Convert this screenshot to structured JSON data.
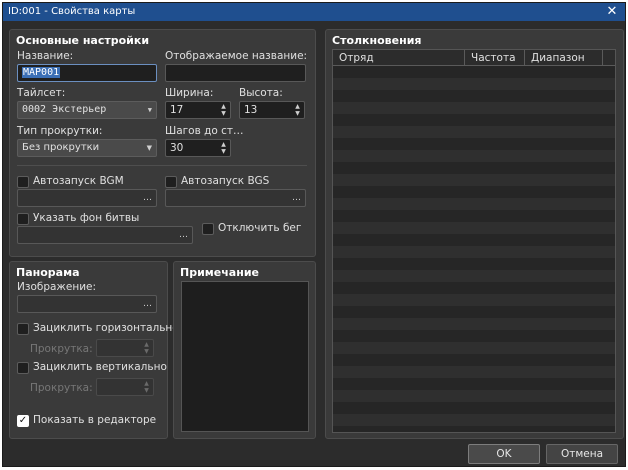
{
  "window": {
    "title": "ID:001 - Свойства карты",
    "close_glyph": "✕"
  },
  "general": {
    "title": "Основные настройки",
    "name_label": "Название:",
    "name_value": "MAP001",
    "display_name_label": "Отображаемое название:",
    "display_name_value": "",
    "tileset_label": "Тайлсет:",
    "tileset_value": "0002 Экстерьер",
    "width_label": "Ширина:",
    "width_value": "17",
    "height_label": "Высота:",
    "height_value": "13",
    "scroll_type_label": "Тип прокрутки:",
    "scroll_type_value": "Без прокрутки",
    "encounter_steps_label": "Шагов до ст…",
    "encounter_steps_value": "30",
    "autoplay_bgm_label": "Автозапуск BGM",
    "autoplay_bgm_checked": false,
    "autoplay_bgs_label": "Автозапуск BGS",
    "autoplay_bgs_checked": false,
    "battleback_label": "Указать фон битвы",
    "battleback_checked": false,
    "disable_dash_label": "Отключить бег",
    "disable_dash_checked": false
  },
  "panorama": {
    "title": "Панорама",
    "image_label": "Изображение:",
    "loop_h_label": "Зациклить горизонтально",
    "loop_h_checked": false,
    "scroll_h_label": "Прокрутка:",
    "loop_v_label": "Зациклить вертикально",
    "loop_v_checked": false,
    "scroll_v_label": "Прокрутка:",
    "show_in_editor_label": "Показать в редакторе",
    "show_in_editor_checked": true
  },
  "note": {
    "title": "Примечание",
    "value": ""
  },
  "encounters": {
    "title": "Столкновения",
    "columns": [
      "Отряд",
      "Частота",
      "Диапазон"
    ],
    "rows": []
  },
  "buttons": {
    "ok": "OK",
    "cancel": "Отмена"
  },
  "icons": {
    "dropdown": "▼",
    "spin_up": "▲",
    "spin_down": "▼",
    "browse": "…",
    "check": "✓"
  },
  "colors": {
    "titlebar": "#1f4f8f",
    "panel": "#3a3a3a",
    "background": "#2c2c2c",
    "selection": "#3b6fb5"
  }
}
